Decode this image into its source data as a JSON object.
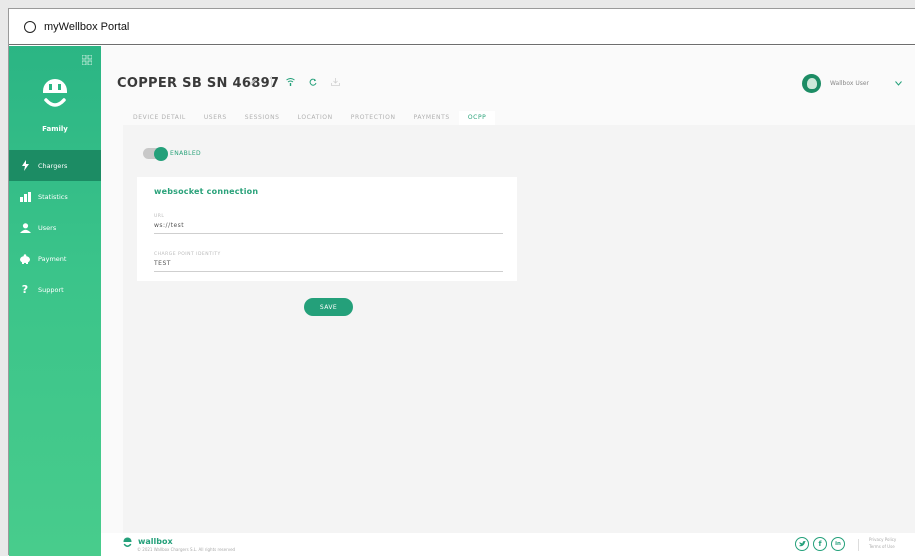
{
  "window": {
    "title": "myWellbox Portal"
  },
  "sidebar": {
    "brand_label": "Family",
    "items": [
      {
        "label": "Chargers",
        "icon": "lightning-icon",
        "active": true
      },
      {
        "label": "Statistics",
        "icon": "bar-chart-icon",
        "active": false
      },
      {
        "label": "Users",
        "icon": "user-icon",
        "active": false
      },
      {
        "label": "Payment",
        "icon": "piggy-bank-icon",
        "active": false
      },
      {
        "label": "Support",
        "icon": "question-icon",
        "active": false
      }
    ]
  },
  "header": {
    "device_title": "COPPER SB SN 46897",
    "user_name": "Wallbox User"
  },
  "tabs": [
    {
      "label": "DEVICE DETAIL",
      "active": false
    },
    {
      "label": "USERS",
      "active": false
    },
    {
      "label": "SESSIONS",
      "active": false
    },
    {
      "label": "LOCATION",
      "active": false
    },
    {
      "label": "PROTECTION",
      "active": false
    },
    {
      "label": "PAYMENTS",
      "active": false
    },
    {
      "label": "OCPP",
      "active": true
    }
  ],
  "ocpp": {
    "toggle_label": "ENABLED",
    "card_title": "websocket connection",
    "url_label": "URL",
    "url_value": "ws://test",
    "identity_label": "CHARGE POINT IDENTITY",
    "identity_value": "TEST",
    "save_label": "SAVE"
  },
  "footer": {
    "brand": "wallbox",
    "copyright": "© 2021 Wallbox Chargers S.L. All rights reserved",
    "privacy": "Privacy Policy",
    "terms": "Terms of Use",
    "socials": [
      "twitter-icon",
      "facebook-icon",
      "linkedin-icon"
    ]
  },
  "colors": {
    "accent": "#24a07a",
    "sidebar_active": "#1c8c64",
    "sidebar_top": "#2bb584",
    "sidebar_bottom": "#48cc8c"
  }
}
